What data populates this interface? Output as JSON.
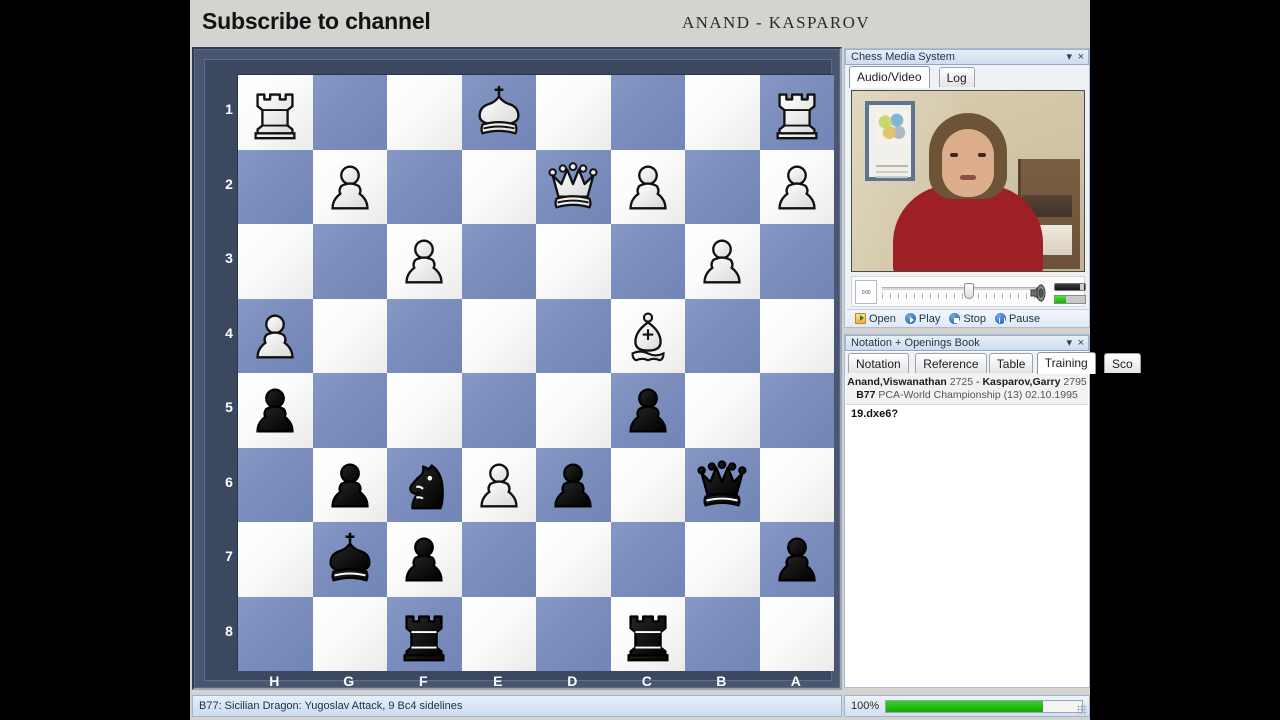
{
  "banner": {
    "title": "Subscribe to channel",
    "subtitle": "ANAND - KASPAROV"
  },
  "board": {
    "orientation": "black-at-top-left (flipped: files H..A, ranks 1..8)",
    "rank_labels": [
      "1",
      "2",
      "3",
      "4",
      "5",
      "6",
      "7",
      "8"
    ],
    "file_labels": [
      "H",
      "G",
      "F",
      "E",
      "D",
      "C",
      "B",
      "A"
    ],
    "light_square_color": "#f7f6f5",
    "dark_square_color": "#7b8dbc",
    "frame_color": "#3c4860",
    "rows": [
      [
        {
          "piece": "white-rook"
        },
        {
          "piece": null
        },
        {
          "piece": null
        },
        {
          "piece": "white-king"
        },
        {
          "piece": null
        },
        {
          "piece": null
        },
        {
          "piece": null
        },
        {
          "piece": "white-rook"
        }
      ],
      [
        {
          "piece": null
        },
        {
          "piece": "white-pawn"
        },
        {
          "piece": null
        },
        {
          "piece": null
        },
        {
          "piece": "white-queen"
        },
        {
          "piece": "white-pawn"
        },
        {
          "piece": null
        },
        {
          "piece": "white-pawn"
        }
      ],
      [
        {
          "piece": null
        },
        {
          "piece": null
        },
        {
          "piece": "white-pawn"
        },
        {
          "piece": null
        },
        {
          "piece": null
        },
        {
          "piece": null
        },
        {
          "piece": "white-pawn"
        },
        {
          "piece": null
        }
      ],
      [
        {
          "piece": "white-pawn"
        },
        {
          "piece": null
        },
        {
          "piece": null
        },
        {
          "piece": null
        },
        {
          "piece": null
        },
        {
          "piece": "white-bishop"
        },
        {
          "piece": null
        },
        {
          "piece": null
        }
      ],
      [
        {
          "piece": "black-pawn"
        },
        {
          "piece": null
        },
        {
          "piece": null
        },
        {
          "piece": null
        },
        {
          "piece": null
        },
        {
          "piece": "black-pawn"
        },
        {
          "piece": null
        },
        {
          "piece": null
        }
      ],
      [
        {
          "piece": null
        },
        {
          "piece": "black-pawn"
        },
        {
          "piece": "black-knight"
        },
        {
          "piece": "white-pawn"
        },
        {
          "piece": "black-pawn"
        },
        {
          "piece": null
        },
        {
          "piece": "black-queen"
        },
        {
          "piece": null
        }
      ],
      [
        {
          "piece": null
        },
        {
          "piece": "black-king"
        },
        {
          "piece": "black-pawn"
        },
        {
          "piece": null
        },
        {
          "piece": null
        },
        {
          "piece": null
        },
        {
          "piece": null
        },
        {
          "piece": "black-pawn"
        }
      ],
      [
        {
          "piece": null
        },
        {
          "piece": null
        },
        {
          "piece": "black-rook"
        },
        {
          "piece": null
        },
        {
          "piece": null
        },
        {
          "piece": "black-rook"
        },
        {
          "piece": null
        },
        {
          "piece": null
        }
      ]
    ]
  },
  "media_panel": {
    "title": "Chess Media System",
    "caret": "▾",
    "close": "×",
    "tabs": [
      {
        "label": "Audio/Video",
        "active": true
      },
      {
        "label": "Log",
        "active": false
      }
    ],
    "time_display": "0:00",
    "buttons": [
      {
        "label": "Open",
        "icon": "folder-open-icon"
      },
      {
        "label": "Play",
        "icon": "play-icon"
      },
      {
        "label": "Stop",
        "icon": "stop-icon"
      },
      {
        "label": "Pause",
        "icon": "pause-icon"
      }
    ]
  },
  "notation_panel": {
    "title": "Notation + Openings Book",
    "caret": "▾",
    "close": "×",
    "tabs": [
      {
        "label": "Notation",
        "active": false
      },
      {
        "label": "Reference",
        "active": false
      },
      {
        "label": "Table",
        "active": false
      },
      {
        "label": "Training",
        "active": true
      },
      {
        "label": "Sco",
        "active": false
      }
    ],
    "scroll_left": "◀",
    "scroll_right": "▶",
    "game_header": {
      "white": "Anand,Viswanathan",
      "white_elo": "2725",
      "separator": "-",
      "black": "Kasparov,Garry",
      "black_elo": "2795",
      "eco": "B77",
      "event": "PCA-World Championship (13) 02.10.1995"
    },
    "moves": "19.dxe6?"
  },
  "status_bar": {
    "text": "B77: Sicilian Dragon: Yugoslav Attack, 9 Bc4 sidelines"
  },
  "progress": {
    "percent_label": "100%",
    "value": 100,
    "fill_color": "#16a800"
  }
}
